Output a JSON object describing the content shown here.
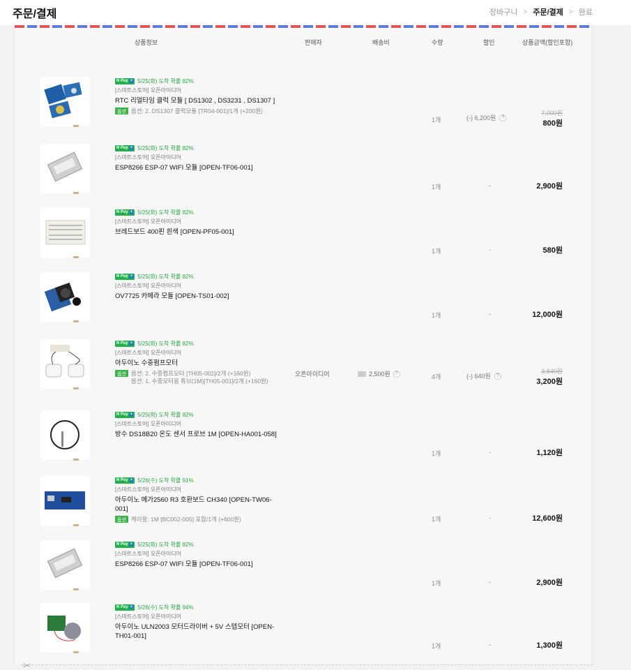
{
  "header": {
    "title": "주문/결제",
    "steps": [
      "장바구니",
      "주문/결제",
      "완료"
    ],
    "current_step": 1
  },
  "columns": {
    "product": "상품정보",
    "seller": "판매자",
    "shipping": "배송비",
    "qty": "수량",
    "discount": "할인",
    "amount": "상품금액(할인포함)"
  },
  "colors": {
    "npay_green": "#20b04a",
    "option_badge": "#3bb04b",
    "airmail_red": "#e35454",
    "airmail_blue": "#5b7fd6"
  },
  "npay_label": "N Pay",
  "npay_plus": "+",
  "option_badge": "옵션",
  "items": [
    {
      "delivery": "5/25(화) 도착 확률 82%",
      "store": "[스마트스토어] 오픈아이디어",
      "name": "RTC 리얼타임 클럭 모듈 [ DS1302 , DS3231 , DS1307 ]",
      "options": [
        "옵션: 2. DS1307 클럭모듈 [TR04-001]/1개 (+200원)"
      ],
      "qty": "1개",
      "discount": "(-) 6,200원",
      "original_price": "7,000원",
      "price": "800원",
      "icon": "rtc-module-image"
    },
    {
      "delivery": "5/25(화) 도착 확률 82%",
      "store": "[스마트스토어] 오픈아이디어",
      "name": "ESP8266 ESP-07 WIFI 모듈 [OPEN-TF06-001]",
      "options": [],
      "qty": "1개",
      "discount": "-",
      "price": "2,900원",
      "icon": "esp8266-image"
    },
    {
      "delivery": "5/25(화) 도착 확률 82%",
      "store": "[스마트스토어] 오픈아이디어",
      "name": "브레드보드 400핀 흰색 [OPEN-PF05-001]",
      "options": [],
      "qty": "1개",
      "discount": "-",
      "price": "580원",
      "icon": "breadboard-image"
    },
    {
      "delivery": "5/25(화) 도착 확률 82%",
      "store": "[스마트스토어] 오픈아이디어",
      "name": "OV7725 카메라 모듈 [OPEN-TS01-002]",
      "options": [],
      "qty": "1개",
      "discount": "-",
      "price": "12,000원",
      "icon": "camera-module-image"
    },
    {
      "delivery": "5/25(화) 도착 확률 82%",
      "store": "[스마트스토어] 오픈아이디어",
      "name": "아두이노 수중펌프모터",
      "options": [
        "옵션: 2. 수중펌프모터 [TH05-002]/2개 (+160원)",
        "옵션: 1. 수중모터용 튜브(1M)[TH05-001]/2개 (+160원)"
      ],
      "seller": "오픈아이디어",
      "shipping": "2,500원",
      "qty": "4개",
      "discount": "(-) 640원",
      "original_price": "3,840원",
      "price": "3,200원",
      "icon": "water-pump-image"
    },
    {
      "delivery": "5/25(화) 도착 확률 82%",
      "store": "[스마트스토어] 오픈아이디어",
      "name": "방수 DS18B20 온도 센서 프로브 1M [OPEN-HA001-058]",
      "options": [],
      "qty": "1개",
      "discount": "-",
      "price": "1,120원",
      "icon": "temperature-probe-image"
    },
    {
      "delivery": "5/26(수) 도착 확률 91%",
      "store": "[스마트스토어] 오픈아이디어",
      "name": "아두이노 메가2560 R3 호환보드 CH340 [OPEN-TW06-001]",
      "options": [
        "케이블: 1M [BC002-005] 포함/1개 (+600원)"
      ],
      "qty": "1개",
      "discount": "-",
      "price": "12,600원",
      "icon": "arduino-mega-image"
    },
    {
      "delivery": "5/25(화) 도착 확률 82%",
      "store": "[스마트스토어] 오픈아이디어",
      "name": "ESP8266 ESP-07 WIFI 모듈 [OPEN-TF06-001]",
      "options": [],
      "qty": "1개",
      "discount": "-",
      "price": "2,900원",
      "icon": "esp8266-image"
    },
    {
      "delivery": "5/26(수) 도착 확률 94%",
      "store": "[스마트스토어] 오픈아이디어",
      "name": "아두이노 ULN2003 모터드라이버 + 5V 스텝모터 [OPEN-TH01-001]",
      "options": [],
      "qty": "1개",
      "discount": "-",
      "price": "1,300원",
      "icon": "stepper-motor-image"
    }
  ]
}
